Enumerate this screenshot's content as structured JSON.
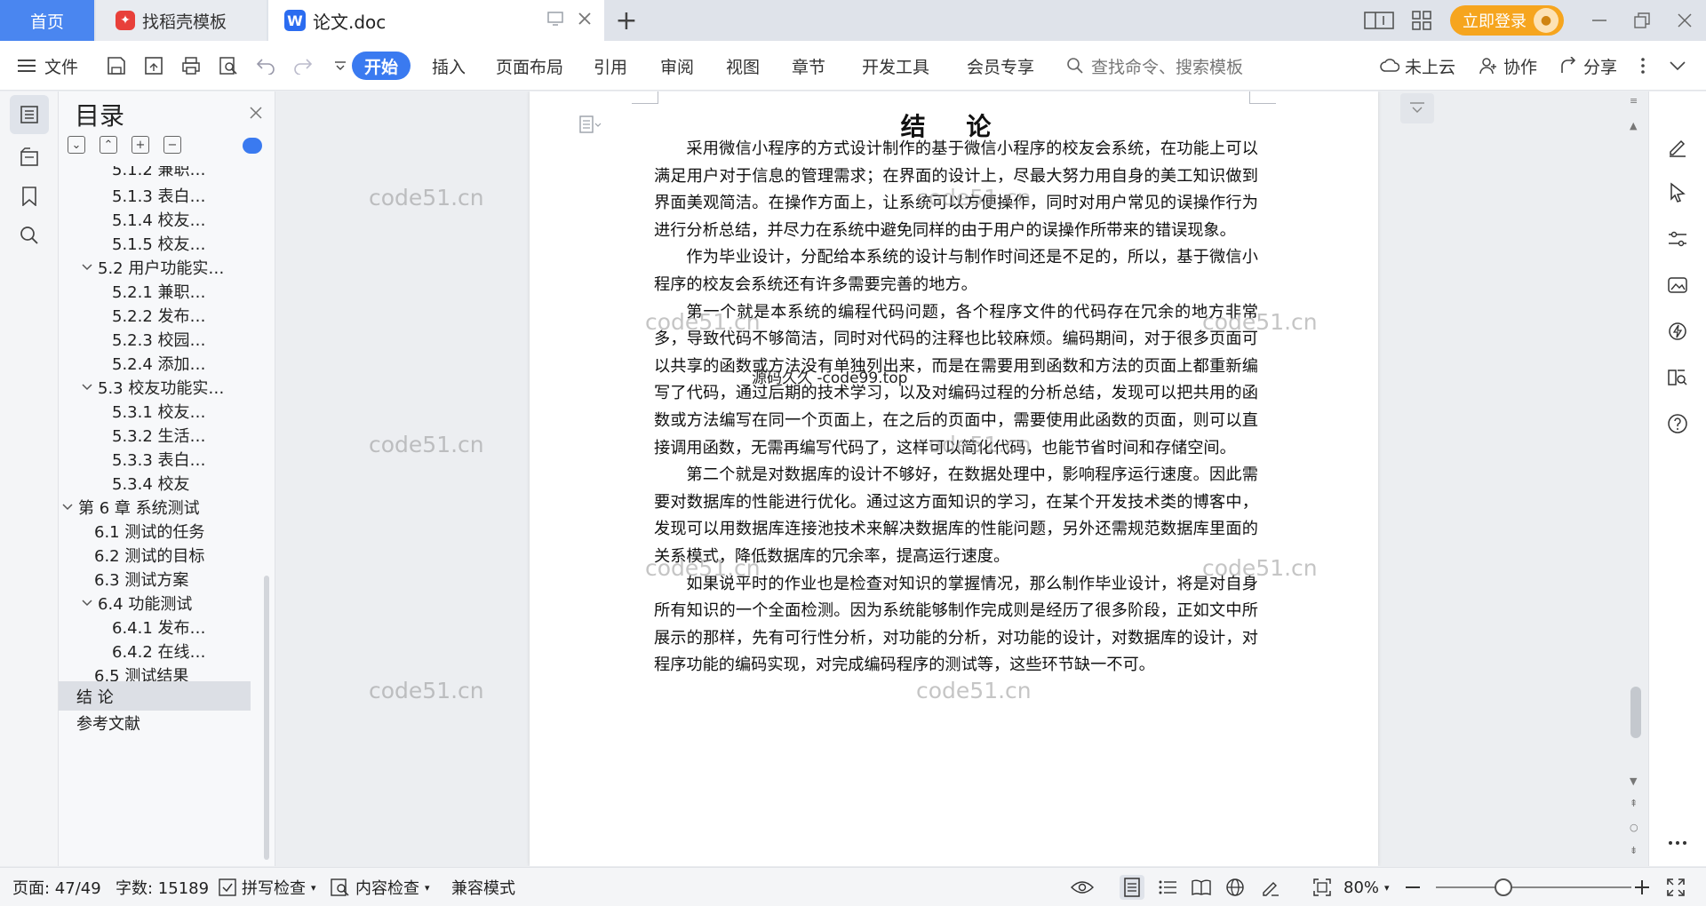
{
  "tabs": {
    "home": "首页",
    "templates": "找稻壳模板",
    "document": "论文.doc",
    "new_tab": "+"
  },
  "titlebar": {
    "login": "立即登录"
  },
  "ribbon": {
    "file": "文件",
    "start": "开始",
    "tabs": [
      "插入",
      "页面布局",
      "引用",
      "审阅",
      "视图",
      "章节",
      "开发工具",
      "会员专享"
    ],
    "search_placeholder": "查找命令、搜索模板",
    "cloud": "未上云",
    "collab": "协作",
    "share": "分享"
  },
  "toc": {
    "title": "目录",
    "items": [
      {
        "label": "5.1.2 兼职…"
      },
      {
        "label": "5.1.3 表白…"
      },
      {
        "label": "5.1.4 校友…"
      },
      {
        "label": "5.1.5 校友…"
      },
      {
        "label": "5.2 用户功能实…"
      },
      {
        "label": "5.2.1 兼职…"
      },
      {
        "label": "5.2.2 发布…"
      },
      {
        "label": "5.2.3 校园…"
      },
      {
        "label": "5.2.4 添加…"
      },
      {
        "label": "5.3 校友功能实…"
      },
      {
        "label": "5.3.1 校友…"
      },
      {
        "label": "5.3.2 生活…"
      },
      {
        "label": "5.3.3 表白…"
      },
      {
        "label": "5.3.4 校友"
      },
      {
        "label": "第 6 章  系统测试"
      },
      {
        "label": "6.1 测试的任务"
      },
      {
        "label": "6.2 测试的目标"
      },
      {
        "label": "6.3 测试方案"
      },
      {
        "label": "6.4 功能测试"
      },
      {
        "label": "6.4.1 发布…"
      },
      {
        "label": "6.4.2 在线…"
      },
      {
        "label": "6.5 测试结果"
      },
      {
        "label": "结  论"
      },
      {
        "label": "参考文献"
      }
    ]
  },
  "document": {
    "title": "结  论",
    "paragraphs": [
      "采用微信小程序的方式设计制作的基于微信小程序的校友会系统，在功能上可以满足用户对于信息的管理需求；在界面的设计上，尽最大努力用自身的美工知识做到界面美观简洁。在操作方面上，让系统可以方便操作，同时对用户常见的误操作行为进行分析总结，并尽力在系统中避免同样的由于用户的误操作所带来的错误现象。",
      "作为毕业设计，分配给本系统的设计与制作时间还是不足的，所以，基于微信小程序的校友会系统还有许多需要完善的地方。",
      "第一个就是本系统的编程代码问题，各个程序文件的代码存在冗余的地方非常多，导致代码不够简洁，同时对代码的注释也比较麻烦。编码期间，对于很多页面可以共享的函数或方法没有单独列出来，而是在需要用到函数和方法的页面上都重新编写了代码，通过后期的技术学习，以及对编码过程的分析总结，发现可以把共用的函数或方法编写在同一个页面上，在之后的页面中，需要使用此函数的页面，则可以直接调用函数，无需再编写代码了，这样可以简化代码，也能节省时间和存储空间。",
      "第二个就是对数据库的设计不够好，在数据处理中，影响程序运行速度。因此需要对数据库的性能进行优化。通过这方面知识的学习，在某个开发技术类的博客中，发现可以用数据库连接池技术来解决数据库的性能问题，另外还需规范数据库里面的关系模式，降低数据库的冗余率，提高运行速度。",
      "如果说平时的作业也是检查对知识的掌握情况，那么制作毕业设计，将是对自身所有知识的一个全面检测。因为系统能够制作完成则是经历了很多阶段，正如文中所展示的那样，先有可行性分析，对功能的分析，对功能的设计，对数据库的设计，对程序功能的编码实现，对完成编码程序的测试等，这些环节缺一不可。"
    ],
    "overlay": "源码久久 -code99.top",
    "watermark": "code51.cn"
  },
  "status": {
    "page": "页面: 47/49",
    "words": "字数: 15189",
    "spell": "拼写检查",
    "content_check": "内容检查",
    "compat": "兼容模式",
    "zoom": "80%"
  }
}
